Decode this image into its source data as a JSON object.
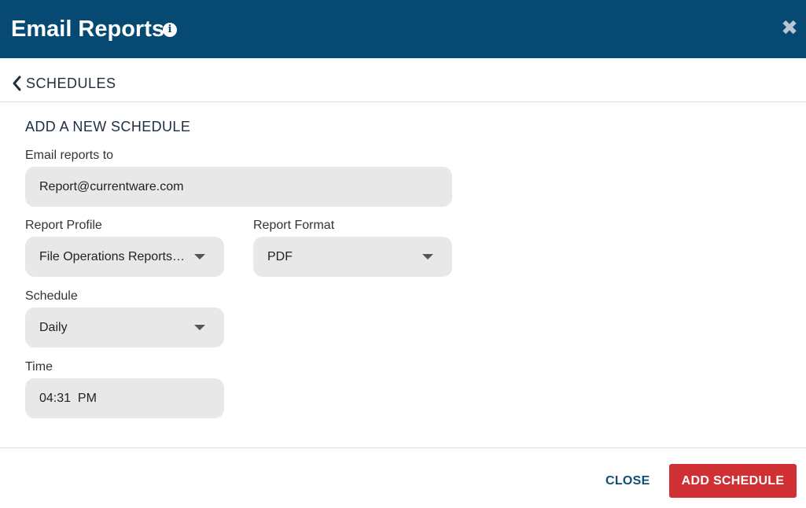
{
  "header": {
    "title": "Email Reports",
    "info_icon": "info-icon",
    "close_icon": "close-icon",
    "background_color": "#064a73"
  },
  "nav": {
    "back_label": "SCHEDULES",
    "back_icon": "chevron-left-icon"
  },
  "form": {
    "section_title": "ADD A NEW SCHEDULE",
    "email": {
      "label": "Email reports to",
      "value": "Report@currentware.com"
    },
    "report_profile": {
      "label": "Report Profile",
      "value": "File Operations Reports- Yesterday"
    },
    "report_format": {
      "label": "Report Format",
      "value": "PDF"
    },
    "schedule": {
      "label": "Schedule",
      "value": "Daily"
    },
    "time": {
      "label": "Time",
      "value": "04:31  PM"
    }
  },
  "footer": {
    "close_label": "CLOSE",
    "add_label": "ADD SCHEDULE",
    "add_color": "#d03034"
  }
}
